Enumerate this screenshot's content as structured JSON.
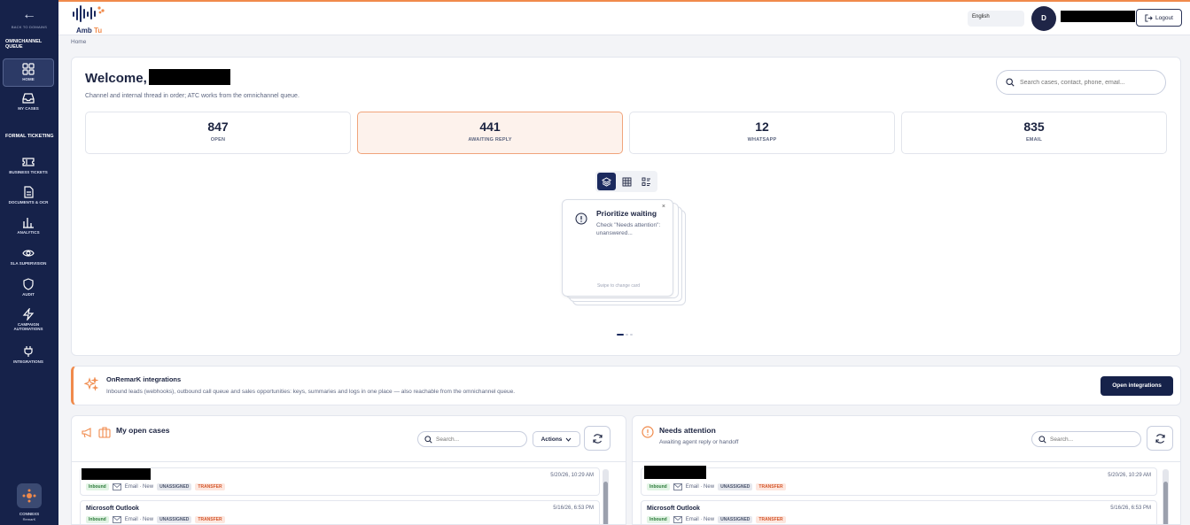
{
  "sidebar": {
    "back_label": "BACK TO DOMAINS",
    "section_omnichannel": "OMNICHANNEL QUEUE",
    "section_ticketing": "FORMAL TICKETING",
    "items": [
      {
        "label": "HOME"
      },
      {
        "label": "MY CASES"
      },
      {
        "label": "BUSINESS TICKETS"
      },
      {
        "label": "DOCUMENTS & OCR"
      },
      {
        "label": "ANALYTICS"
      },
      {
        "label": "SLA SUPERVISION"
      },
      {
        "label": "AUDIT"
      },
      {
        "label": "CAMPAIGN AUTOMATIONS"
      },
      {
        "label": "INTEGRATIONS"
      }
    ],
    "org_name": "CONNEXS",
    "org_sub": "RemarK"
  },
  "header": {
    "brand_prefix": "Amb",
    "brand_suffix": "Tu",
    "language": "English",
    "avatar_initial": "D",
    "logout_label": "Logout"
  },
  "breadcrumb": "Home",
  "welcome": {
    "title": "Welcome, D",
    "subtitle": "Channel and internal thread in order; ATC works from the omnichannel queue.",
    "search_placeholder": "Search cases, contact, phone, email...",
    "stats": [
      {
        "value": "847",
        "label": "OPEN"
      },
      {
        "value": "441",
        "label": "AWAITING REPLY"
      },
      {
        "value": "12",
        "label": "WHATSAPP"
      },
      {
        "value": "835",
        "label": "EMAIL"
      }
    ],
    "card": {
      "title": "Prioritize waiting",
      "body": "Check \"Needs attention\": unanswered...",
      "hint": "Swipe to change card",
      "close": "×"
    }
  },
  "integrations": {
    "title": "OnRemarK integrations",
    "description": "Inbound leads (webhooks), outbound call queue and sales opportunities: keys, summaries and logs in one place — also reachable from the omnichannel queue.",
    "button": "Open integrations"
  },
  "my_cases": {
    "title": "My open cases",
    "search_placeholder": "Search...",
    "actions_label": "Actions",
    "rows": [
      {
        "name": "",
        "date": "5/20/26, 10:29 AM",
        "direction": "Inbound",
        "channel": "Email · New",
        "assign": "UNASSIGNED",
        "action": "TRANSFER"
      },
      {
        "name": "Microsoft Outlook",
        "date": "5/16/26, 6:53 PM",
        "direction": "Inbound",
        "channel": "Email · New",
        "assign": "UNASSIGNED",
        "action": "TRANSFER"
      }
    ]
  },
  "needs_attention": {
    "title": "Needs attention",
    "subtitle": "Awaiting agent reply or handoff",
    "search_placeholder": "Search...",
    "rows": [
      {
        "name": "",
        "date": "5/20/26, 10:29 AM",
        "direction": "Inbound",
        "channel": "Email · New",
        "assign": "UNASSIGNED",
        "action": "TRANSFER"
      },
      {
        "name": "Microsoft Outlook",
        "date": "5/16/26, 6:53 PM",
        "direction": "Inbound",
        "channel": "Email · New",
        "assign": "UNASSIGNED",
        "action": "TRANSFER"
      }
    ]
  },
  "colors": {
    "sidebar_bg": "#16224a",
    "accent": "#f08a4b",
    "primary_text": "#1b2340"
  }
}
